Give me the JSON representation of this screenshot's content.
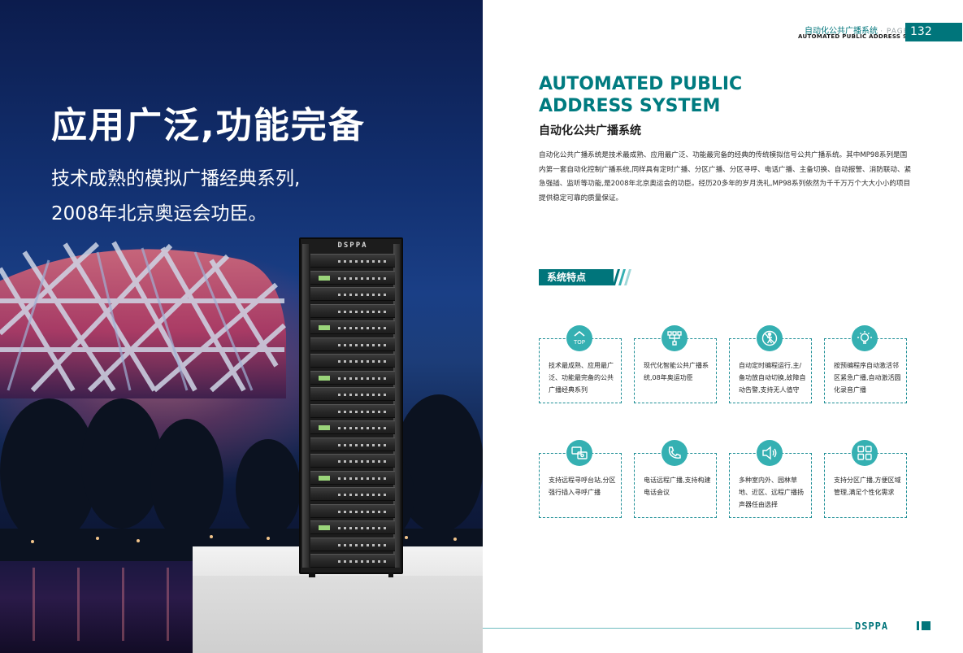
{
  "hero": {
    "title": "应用广泛,功能完备",
    "subtitle_line1": "技术成熟的模拟广播经典系列,",
    "subtitle_line2": "2008年北京奥运会功臣。"
  },
  "product": {
    "rack_logo": "DSPPA"
  },
  "header": {
    "section_cn": "自动化公共广播系统",
    "page_word": "· PAGE",
    "section_en": "AUTOMATED PUBLIC ADDRESS SYSTEM",
    "page_number": "132"
  },
  "main": {
    "title_en_line1": "AUTOMATED PUBLIC",
    "title_en_line2": "ADDRESS SYSTEM",
    "title_cn": "自动化公共广播系统",
    "intro": "自动化公共广播系统是技术最成熟、应用最广泛、功能最完备的经典的传统模拟信号公共广播系统。其中MP98系列是国内第一套自动化控制广播系统,同样具有定时广播、分区广播、分区寻呼、电话广播、主备切换、自动报警、消防联动、紧急强插、监听等功能,是2008年北京奥运会的功臣。经历20多年的岁月洗礼,MP98系列依然为千千万万个大大小小的项目提供稳定可靠的质量保证。",
    "features_heading": "系统特点"
  },
  "features": [
    {
      "icon": "top-icon",
      "text": "技术最成熟、应用最广泛、功能最完备的公共广播经典系列"
    },
    {
      "icon": "network-icon",
      "text": "现代化智能公共广播系统,08年奥运功臣"
    },
    {
      "icon": "unattended-icon",
      "text": "自动定时编程运行,主/备功放自动切换,故障自动告警,支持无人值守"
    },
    {
      "icon": "bulb-icon",
      "text": "按预编程序自动激活邻区紧急广播,自动激活圆化录音广播"
    },
    {
      "icon": "paging-station-icon",
      "text": "支持远程寻呼台站,分区强行插入寻呼广播"
    },
    {
      "icon": "phone-icon",
      "text": "电话远程广播,支持构建电话会议"
    },
    {
      "icon": "speaker-icon",
      "text": "多种室内外、园林草地、近区、远程广播扬声器任由选择"
    },
    {
      "icon": "grid-icon",
      "text": "支持分区广播,方便区域管理,满足个性化需求"
    }
  ],
  "footer": {
    "logo": "DSPPA"
  },
  "colors": {
    "accent": "#00757b",
    "icon_bg": "#35b0b2",
    "card_border": "#1e8f96"
  }
}
